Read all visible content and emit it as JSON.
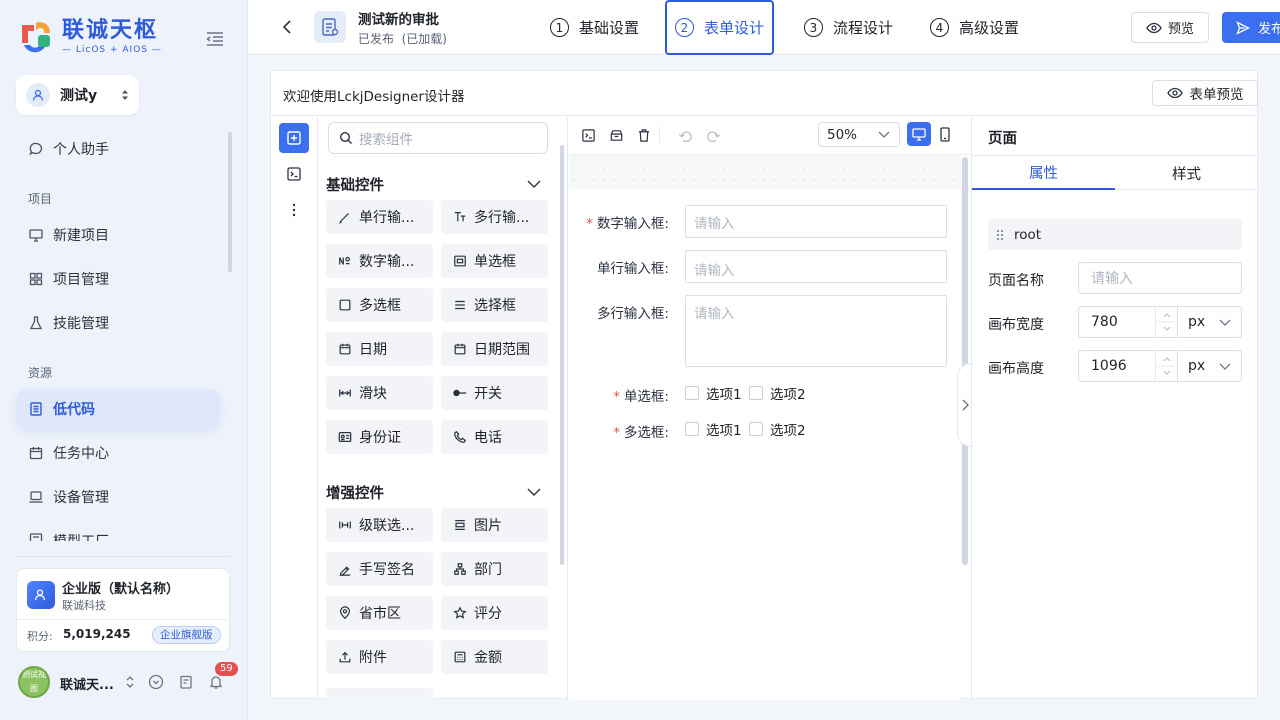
{
  "brand": {
    "name": "联诚天枢",
    "tagline": "— LicOS + AIOS —"
  },
  "tenant": {
    "label": "测试y"
  },
  "nav": {
    "assistant": "个人助手",
    "group_project": "项目",
    "new_project": "新建项目",
    "project_manage": "项目管理",
    "skill_manage": "技能管理",
    "group_resource": "资源",
    "lowcode": "低代码",
    "task_center": "任务中心",
    "device_manage": "设备管理",
    "model_factory": "模型工厂"
  },
  "org": {
    "name": "企业版（默认名称）",
    "company": "联诚科技",
    "points_label": "积分:",
    "points": "5,019,245",
    "badge": "企业旗舰版"
  },
  "user": {
    "name": "联诚天...",
    "avatar_text": "测试视图",
    "notifications": "59"
  },
  "header": {
    "doc_title": "测试新的审批",
    "doc_status": "已发布  (已加载)",
    "preview": "预览",
    "publish": "发布"
  },
  "steps": [
    {
      "num": "1",
      "label": "基础设置"
    },
    {
      "num": "2",
      "label": "表单设计"
    },
    {
      "num": "3",
      "label": "流程设计"
    },
    {
      "num": "4",
      "label": "高级设置"
    }
  ],
  "designer": {
    "welcome": "欢迎使用LckjDesigner设计器",
    "form_preview": "表单预览"
  },
  "components": {
    "search_placeholder": "搜索组件",
    "basic_title": "基础控件",
    "basic": [
      {
        "label": "单行输...",
        "icon": "pen-icon"
      },
      {
        "label": "多行输...",
        "icon": "text-icon"
      },
      {
        "label": "数字输...",
        "icon": "number-icon"
      },
      {
        "label": "单选框",
        "icon": "radio-icon"
      },
      {
        "label": "多选框",
        "icon": "checkbox-icon"
      },
      {
        "label": "选择框",
        "icon": "list-icon"
      },
      {
        "label": "日期",
        "icon": "calendar-icon"
      },
      {
        "label": "日期范围",
        "icon": "calendar-range-icon"
      },
      {
        "label": "滑块",
        "icon": "slider-icon"
      },
      {
        "label": "开关",
        "icon": "switch-icon"
      },
      {
        "label": "身份证",
        "icon": "id-card-icon"
      },
      {
        "label": "电话",
        "icon": "phone-icon"
      }
    ],
    "enhanced_title": "增强控件",
    "enhanced": [
      {
        "label": "级联选...",
        "icon": "cascader-icon"
      },
      {
        "label": "图片",
        "icon": "image-icon"
      },
      {
        "label": "手写签名",
        "icon": "signature-icon"
      },
      {
        "label": "部门",
        "icon": "org-tree-icon"
      },
      {
        "label": "省市区",
        "icon": "location-icon"
      },
      {
        "label": "评分",
        "icon": "star-icon"
      },
      {
        "label": "附件",
        "icon": "upload-icon"
      },
      {
        "label": "金额",
        "icon": "calculator-icon"
      }
    ]
  },
  "canvas": {
    "zoom": "50%",
    "fields": [
      {
        "label": "数字输入框:",
        "required": true,
        "placeholder": "请输入"
      },
      {
        "label": "单行输入框:",
        "required": false,
        "placeholder": "请输入"
      },
      {
        "label": "多行输入框:",
        "required": false,
        "placeholder": "请输入"
      }
    ],
    "radio": {
      "label": "单选框:",
      "required": true,
      "options": [
        "选项1",
        "选项2"
      ]
    },
    "checkbox": {
      "label": "多选框:",
      "required": true,
      "options": [
        "选项1",
        "选项2"
      ]
    }
  },
  "props": {
    "title": "页面",
    "tab_attr": "属性",
    "tab_style": "样式",
    "root": "root",
    "page_name_label": "页面名称",
    "page_name_placeholder": "请输入",
    "width_label": "画布宽度",
    "width_value": "780",
    "height_label": "画布高度",
    "height_value": "1096",
    "unit": "px"
  },
  "colors": {
    "accent": "#3c6ef0",
    "required": "#e45050",
    "sidebar_bg": "#eef3fb"
  }
}
